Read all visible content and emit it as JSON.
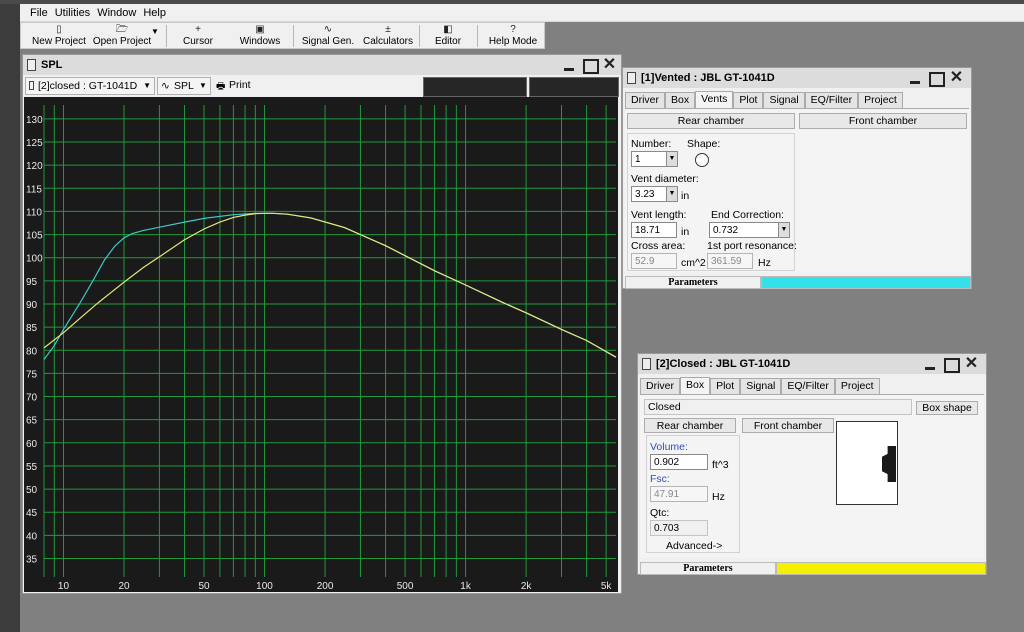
{
  "menu": [
    "File",
    "Utilities",
    "Window",
    "Help"
  ],
  "toolbar": {
    "new_project": "New Project",
    "open_project": "Open Project",
    "cursor": "Cursor",
    "windows": "Windows",
    "signal_gen": "Signal Gen.",
    "calculators": "Calculators",
    "editor": "Editor",
    "help_mode": "Help Mode"
  },
  "spl_window": {
    "title": "SPL",
    "project_select": "[2]closed : GT-1041D",
    "plot_select": "SPL",
    "print": "Print"
  },
  "vented_window": {
    "title": "[1]Vented : JBL GT-1041D",
    "tabs": [
      "Driver",
      "Box",
      "Vents",
      "Plot",
      "Signal",
      "EQ/Filter",
      "Project"
    ],
    "selected_tab": "Vents",
    "rear_chamber": "Rear chamber",
    "front_chamber": "Front chamber",
    "number_label": "Number:",
    "number_value": "1",
    "shape_label": "Shape:",
    "vent_diameter_label": "Vent diameter:",
    "vent_diameter_value": "3.23",
    "vent_diameter_unit": "in",
    "vent_length_label": "Vent length:",
    "vent_length_value": "18.71",
    "vent_length_unit": "in",
    "end_correction_label": "End Correction:",
    "end_correction_value": "0.732",
    "cross_area_label": "Cross area:",
    "cross_area_value": "52.9",
    "cross_area_unit": "cm^2",
    "port_resonance_label": "1st port resonance:",
    "port_resonance_value": "361.59",
    "port_resonance_unit": "Hz",
    "status": "Parameters",
    "status_color": "#33e1eb"
  },
  "closed_window": {
    "title": "[2]Closed : JBL GT-1041D",
    "tabs": [
      "Driver",
      "Box",
      "Plot",
      "Signal",
      "EQ/Filter",
      "Project"
    ],
    "selected_tab": "Box",
    "type": "Closed",
    "box_shape": "Box shape",
    "rear_chamber": "Rear chamber",
    "front_chamber": "Front chamber",
    "volume_label": "Volume:",
    "volume_value": "0.902",
    "volume_unit": "ft^3",
    "fsc_label": "Fsc:",
    "fsc_value": "47.91",
    "fsc_unit": "Hz",
    "qtc_label": "Qtc:",
    "qtc_value": "0.703",
    "advanced": "Advanced->",
    "status": "Parameters",
    "status_color": "#f4f000"
  },
  "chart_data": {
    "type": "line",
    "xscale": "log",
    "xlim": [
      8,
      5600
    ],
    "ylim": [
      31,
      133
    ],
    "xticks": [
      10,
      20,
      50,
      100,
      200,
      500,
      1000,
      2000,
      5000
    ],
    "xtick_labels": [
      "10",
      "20",
      "50",
      "100",
      "200",
      "500",
      "1k",
      "2k",
      "5k"
    ],
    "yticks": [
      35,
      40,
      45,
      50,
      55,
      60,
      65,
      70,
      75,
      80,
      85,
      90,
      95,
      100,
      105,
      110,
      115,
      120,
      125,
      130
    ],
    "grid": true,
    "background": "#1a1a1a",
    "grid_color": "#1f9a3a",
    "series": [
      {
        "color": "#3cc8c8",
        "x": [
          8,
          9,
          10,
          12,
          14,
          16,
          18,
          20,
          22,
          25,
          30,
          40,
          50,
          70,
          90,
          110,
          130,
          170,
          250,
          400,
          700,
          1000,
          1500,
          2000,
          3000,
          4000,
          5600
        ],
        "y": [
          78,
          81,
          84.5,
          90,
          95,
          99.5,
          102.5,
          104.3,
          105.2,
          105.9,
          106.6,
          107.7,
          108.5,
          109.3,
          109.6,
          109.6,
          109.4,
          108.6,
          106.5,
          102.6,
          97.2,
          94.1,
          90.5,
          88.1,
          84.5,
          82.1,
          78.5
        ]
      },
      {
        "color": "#e6e67a",
        "x": [
          8,
          10,
          12,
          15,
          20,
          25,
          30,
          40,
          50,
          60,
          70,
          80,
          90,
          100,
          110,
          130,
          170,
          250,
          400,
          700,
          1000,
          1500,
          2000,
          3000,
          4000,
          5600
        ],
        "y": [
          80.5,
          83.8,
          86.8,
          90.4,
          94.7,
          97.9,
          100.2,
          103.9,
          106.2,
          107.7,
          108.7,
          109.2,
          109.5,
          109.6,
          109.6,
          109.4,
          108.6,
          106.5,
          102.6,
          97.2,
          94.1,
          90.5,
          88.1,
          84.5,
          82.1,
          78.5
        ]
      }
    ]
  }
}
